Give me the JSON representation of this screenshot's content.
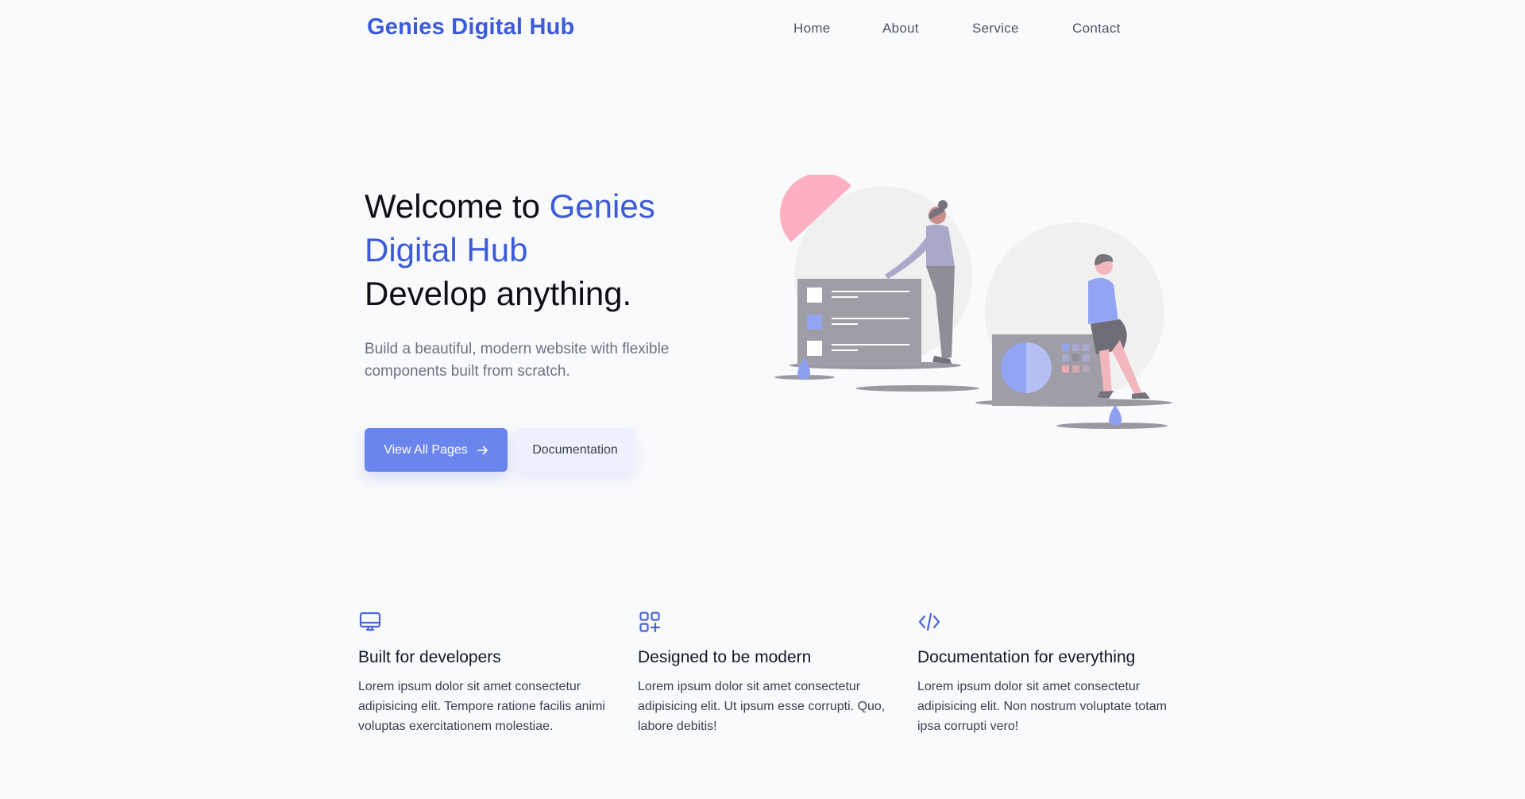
{
  "header": {
    "brand": "Genies Digital Hub",
    "nav": [
      "Home",
      "About",
      "Service",
      "Contact"
    ]
  },
  "hero": {
    "title_prefix": "Welcome to ",
    "title_accent": "Genies Digital Hub",
    "title_line2": "Develop anything.",
    "subtitle": "Build a beautiful, modern website with flexible components built from scratch.",
    "primary_button": "View All Pages",
    "primary_icon": "arrow-right-icon",
    "secondary_button": "Documentation"
  },
  "features": [
    {
      "icon": "desktop-icon",
      "title": "Built for developers",
      "text": "Lorem ipsum dolor sit amet consectetur adipisicing elit. Tempore ratione facilis animi voluptas exercitationem molestiae."
    },
    {
      "icon": "apps-add-icon",
      "title": "Designed to be modern",
      "text": "Lorem ipsum dolor sit amet consectetur adipisicing elit. Ut ipsum esse corrupti. Quo, labore debitis!"
    },
    {
      "icon": "code-icon",
      "title": "Documentation for everything",
      "text": "Lorem ipsum dolor sit amet consectetur adipisicing elit. Non nostrum voluptate totam ipsa corrupti vero!"
    }
  ],
  "colors": {
    "brand": "#3b5bdb",
    "primary_button": "#6b85ee",
    "secondary_button": "#eef0fc",
    "background": "#f9fafb"
  }
}
